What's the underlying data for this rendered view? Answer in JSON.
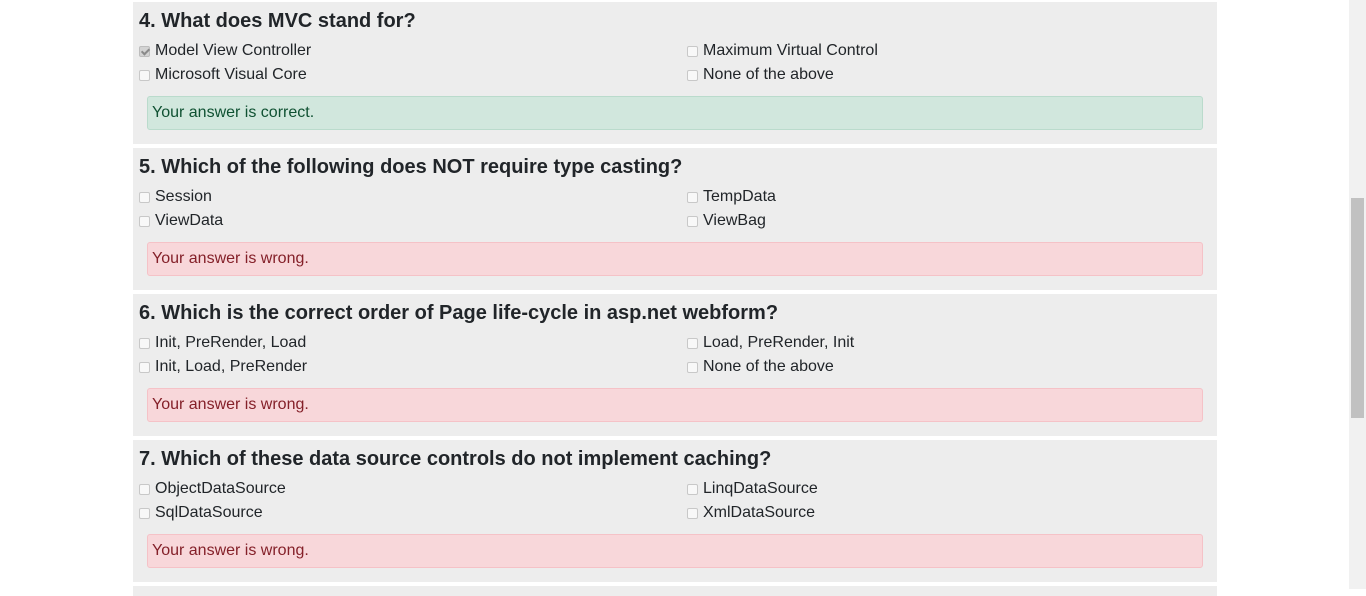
{
  "questions": [
    {
      "title": "4. What does MVC stand for?",
      "options": [
        {
          "label": "Model View Controller",
          "checked": true
        },
        {
          "label": "Maximum Virtual Control",
          "checked": false
        },
        {
          "label": "Microsoft Visual Core",
          "checked": false
        },
        {
          "label": "None of the above",
          "checked": false
        }
      ],
      "result": {
        "text": "Your answer is correct.",
        "status": "correct"
      }
    },
    {
      "title": "5. Which of the following does NOT require type casting?",
      "options": [
        {
          "label": "Session",
          "checked": false
        },
        {
          "label": "TempData",
          "checked": false
        },
        {
          "label": "ViewData",
          "checked": false
        },
        {
          "label": "ViewBag",
          "checked": false
        }
      ],
      "result": {
        "text": "Your answer is wrong.",
        "status": "wrong"
      }
    },
    {
      "title": "6. Which is the correct order of Page life-cycle in asp.net webform?",
      "options": [
        {
          "label": "Init, PreRender, Load",
          "checked": false
        },
        {
          "label": "Load, PreRender, Init",
          "checked": false
        },
        {
          "label": "Init, Load, PreRender",
          "checked": false
        },
        {
          "label": "None of the above",
          "checked": false
        }
      ],
      "result": {
        "text": "Your answer is wrong.",
        "status": "wrong"
      }
    },
    {
      "title": "7. Which of these data source controls do not implement caching?",
      "options": [
        {
          "label": "ObjectDataSource",
          "checked": false
        },
        {
          "label": "LinqDataSource",
          "checked": false
        },
        {
          "label": "SqlDataSource",
          "checked": false
        },
        {
          "label": "XmlDataSource",
          "checked": false
        }
      ],
      "result": {
        "text": "Your answer is wrong.",
        "status": "wrong"
      }
    }
  ],
  "colors": {
    "card_background": "#ededed",
    "correct_background": "#d1e7dd",
    "correct_text": "#0f5132",
    "wrong_background": "#f8d7da",
    "wrong_text": "#842029"
  }
}
